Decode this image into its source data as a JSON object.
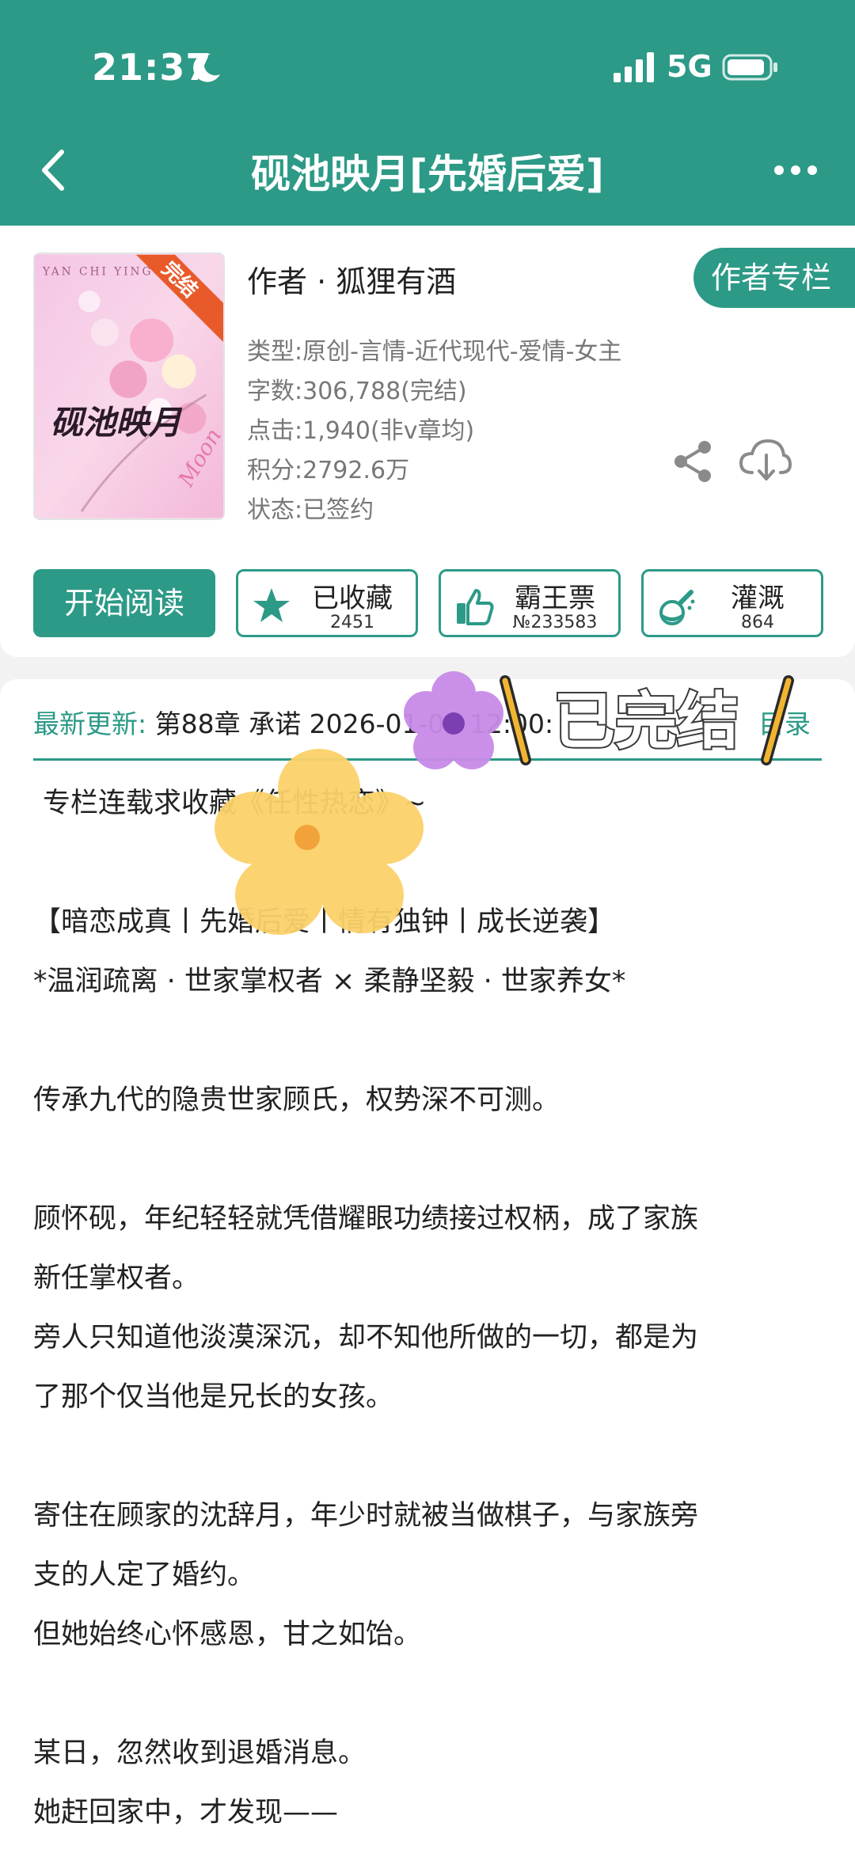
{
  "status_bar": {
    "time": "21:37",
    "network": "5G"
  },
  "nav": {
    "title": "砚池映月[先婚后爱]"
  },
  "book": {
    "cover_badge": "完结",
    "cover_title": "砚池映月",
    "author": "作者 · 狐狸有酒",
    "author_button": "作者专栏",
    "type": "类型:原创-言情-近代现代-爱情-女主",
    "words": "字数:306,788(完结)",
    "clicks": "点击:1,940(非v章均)",
    "score": "积分:2792.6万",
    "status": "状态:已签约"
  },
  "actions": {
    "read": "开始阅读",
    "collect_label": "已收藏",
    "collect_count": "2451",
    "ticket_label": "霸王票",
    "ticket_count": "№233583",
    "water_label": "灌溉",
    "water_count": "864"
  },
  "update": {
    "label": "最新更新:",
    "text": "第88章 承诺 2026-01-06 12:00:",
    "catalog": "目录"
  },
  "sticker": {
    "text": "已完结"
  },
  "synopsis": [
    "专栏连载求收藏《任性热恋》~",
    "【暗恋成真丨先婚后爱丨情有独钟丨成长逆袭】",
    "*温润疏离 · 世家掌权者 × 柔静坚毅 · 世家养女*",
    "传承九代的隐贵世家顾氏，权势深不可测。",
    "顾怀砚，年纪轻轻就凭借耀眼功绩接过权柄，成了家族",
    "新任掌权者。",
    "旁人只知道他淡漠深沉，却不知他所做的一切，都是为",
    "了那个仅当他是兄长的女孩。",
    "寄住在顾家的沈辞月，年少时就被当做棋子，与家族旁",
    "支的人定了婚约。",
    "但她始终心怀感恩，甘之如饴。",
    "某日，忽然收到退婚消息。",
    "她赶回家中，才发现——"
  ],
  "colors": {
    "accent": "#2c9a87"
  }
}
